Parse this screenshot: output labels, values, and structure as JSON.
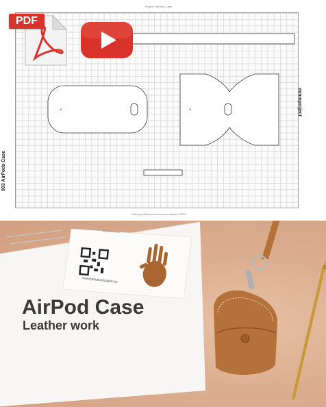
{
  "pattern_sheet": {
    "project_title": "903 AirPods Case",
    "brand": "mmmproject",
    "top_caption": "Project: AirPods Case",
    "bottom_caption": "Αυτή η σελίδα εκτυπώνεται σε κλίμακα 100%"
  },
  "badges": {
    "pdf_label": "PDF",
    "pdf_color": "#d8322a",
    "youtube_color": "#d8322a"
  },
  "photo": {
    "headline": "AirPod Case",
    "subheadline": "Leather work",
    "card_caption": "experience on",
    "card_url": "www.petrakaitsoglou.gr",
    "leather_color": "#b5713a",
    "background_color": "#dcae90"
  }
}
